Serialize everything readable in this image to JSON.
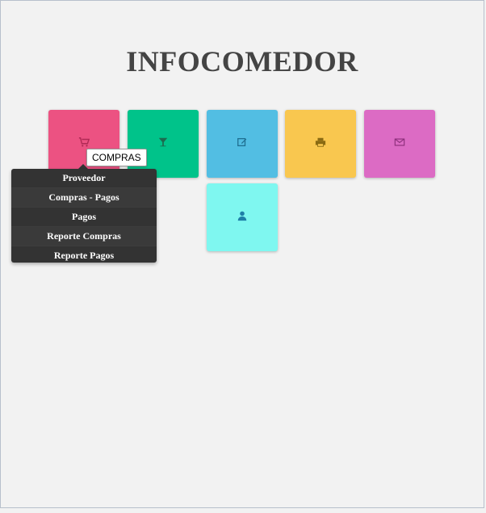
{
  "title": "INFOCOMEDOR",
  "tiles": [
    {
      "icon": "cart-icon",
      "color": "#ec5282"
    },
    {
      "icon": "cocktail-glass-icon",
      "color": "#00c38a"
    },
    {
      "icon": "edit-icon",
      "color": "#52bee3"
    },
    {
      "icon": "printer-icon",
      "color": "#f9c74f"
    },
    {
      "icon": "envelope-icon",
      "color": "#dc6bc4"
    },
    {
      "icon": "user-icon",
      "color": "#7ff7f0"
    }
  ],
  "tooltip": "COMPRAS",
  "menu": {
    "items": [
      "Proveedor",
      "Compras - Pagos",
      "Pagos",
      "Reporte Compras",
      "Reporte Pagos"
    ]
  }
}
